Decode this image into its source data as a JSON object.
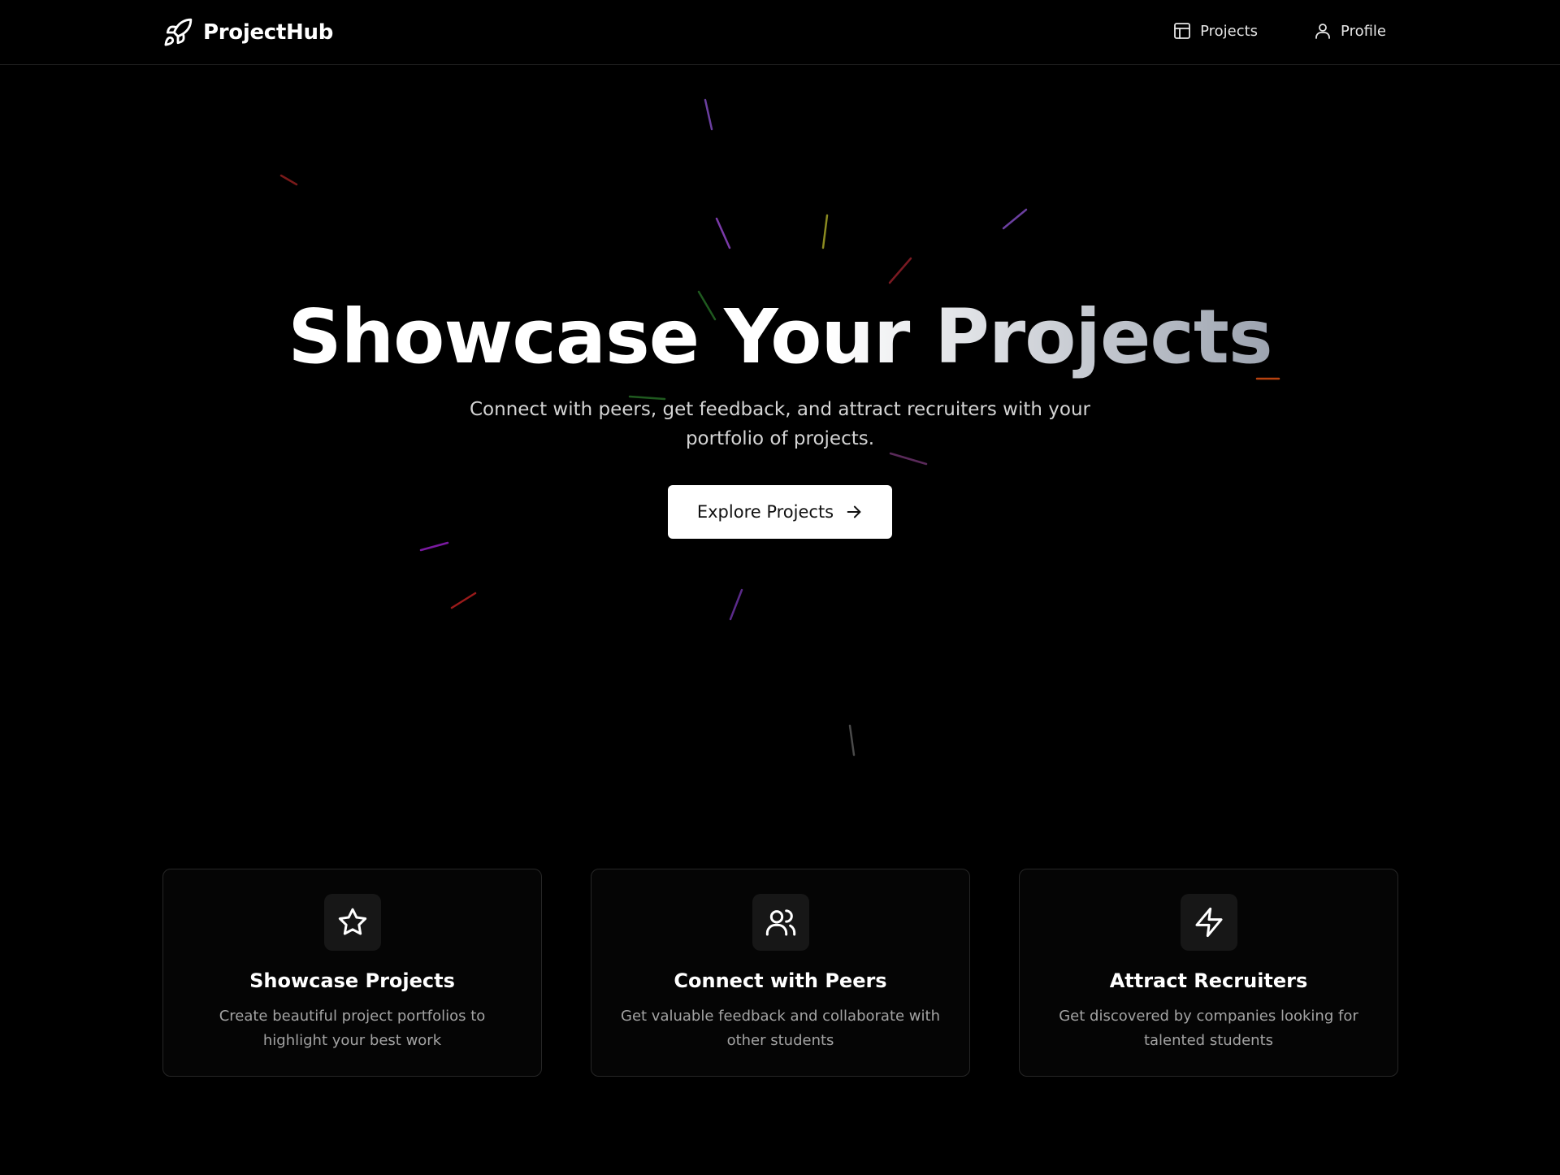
{
  "header": {
    "brand": "ProjectHub",
    "nav": [
      {
        "label": "Projects",
        "icon": "layout-icon"
      },
      {
        "label": "Profile",
        "icon": "user-icon"
      }
    ]
  },
  "hero": {
    "title": "Showcase Your Projects",
    "subtitle": "Connect with peers, get feedback, and attract recruiters with your portfolio of projects.",
    "cta_label": "Explore Projects"
  },
  "features": [
    {
      "icon": "star-icon",
      "title": "Showcase Projects",
      "description": "Create beautiful project portfolios to highlight your best work"
    },
    {
      "icon": "users-icon",
      "title": "Connect with Peers",
      "description": "Get valuable feedback and collaborate with other students"
    },
    {
      "icon": "lightning-icon",
      "title": "Attract Recruiters",
      "description": "Get discovered by companies looking for talented students"
    }
  ],
  "colors": {
    "background": "#000000",
    "accent": "#ffffff",
    "muted_text": "#a3a3a3",
    "card_border": "#262626"
  }
}
